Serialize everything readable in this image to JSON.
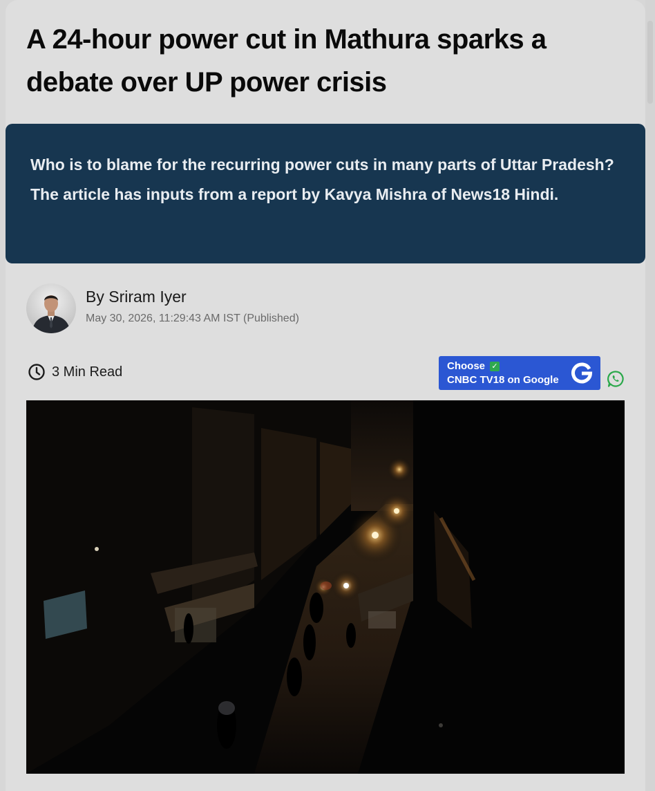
{
  "article": {
    "headline": "A 24-hour power cut in Mathura sparks a debate over UP power crisis",
    "summary": "Who is to blame for the recurring power cuts in many parts of Uttar Pradesh? The article has inputs from a report by Kavya Mishra of News18 Hindi.",
    "author_line": "By Sriram Iyer",
    "published": "May 30, 2026, 11:29:43 AM IST (Published)",
    "read_time": "3 Min Read"
  },
  "google_cta": {
    "line1": "Choose",
    "line2": "CNBC TV18 on Google",
    "check_glyph": "✓"
  },
  "icons": {
    "clock": "clock-icon",
    "whatsapp": "whatsapp-icon",
    "google": "google-g-icon"
  },
  "colors": {
    "summary_bg": "#173650",
    "cta_bg": "#2b57d3",
    "whatsapp": "#2aa84a",
    "page_bg": "#dedede"
  }
}
